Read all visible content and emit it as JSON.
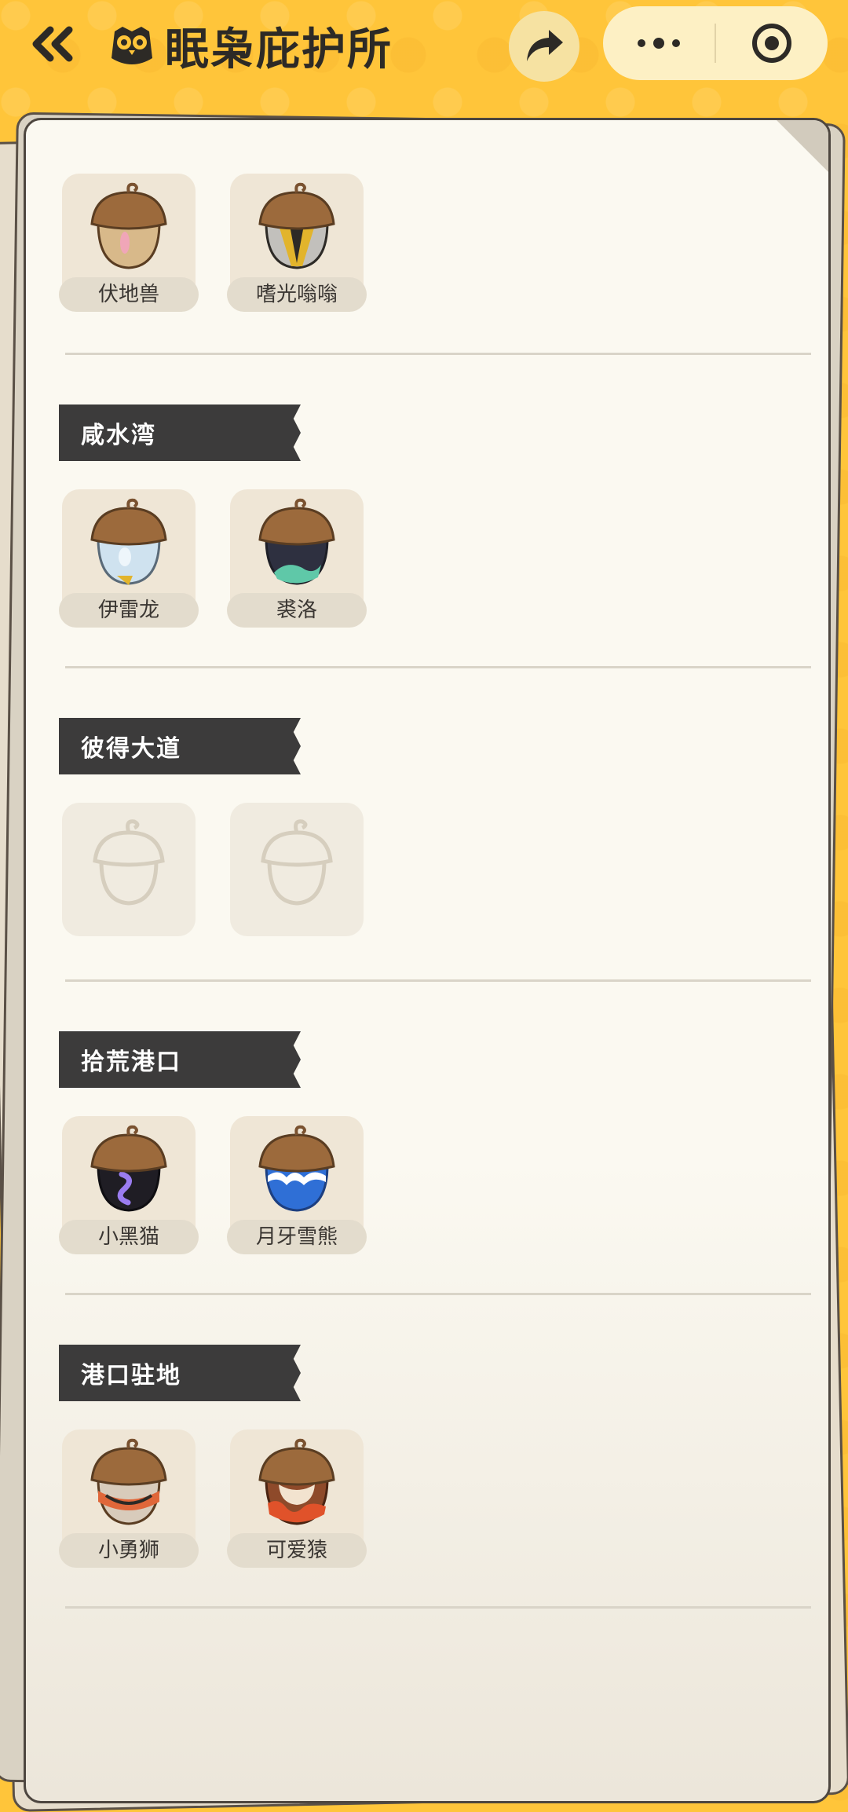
{
  "header": {
    "title": "眠枭庇护所",
    "back_icon": "double-chevron-left-icon",
    "share_icon": "share-arrow-icon",
    "more_icon": "more-dots-icon",
    "close_icon": "target-circle-icon"
  },
  "colors": {
    "background": "#ffc53a",
    "paper": "#fbf9f1",
    "tag": "#3c3b3b",
    "card": "#efe6d6"
  },
  "groups": [
    {
      "title": "",
      "items": [
        {
          "name": "伏地兽",
          "icon": "acorn-tan-icon"
        },
        {
          "name": "嗜光嗡嗡",
          "icon": "acorn-striped-icon"
        }
      ]
    },
    {
      "title": "咸水湾",
      "items": [
        {
          "name": "伊雷龙",
          "icon": "acorn-light-blue-icon"
        },
        {
          "name": "裘洛",
          "icon": "acorn-dark-green-icon"
        }
      ]
    },
    {
      "title": "彼得大道",
      "items": [
        {
          "name": "",
          "icon": "acorn-locked-icon"
        },
        {
          "name": "",
          "icon": "acorn-locked-icon"
        }
      ]
    },
    {
      "title": "拾荒港口",
      "items": [
        {
          "name": "小黑猫",
          "icon": "acorn-black-purple-icon"
        },
        {
          "name": "月牙雪熊",
          "icon": "acorn-blue-wave-icon"
        }
      ]
    },
    {
      "title": "港口驻地",
      "items": [
        {
          "name": "小勇狮",
          "icon": "acorn-orange-stripe-icon"
        },
        {
          "name": "可爱猿",
          "icon": "acorn-red-brown-icon"
        }
      ]
    }
  ]
}
